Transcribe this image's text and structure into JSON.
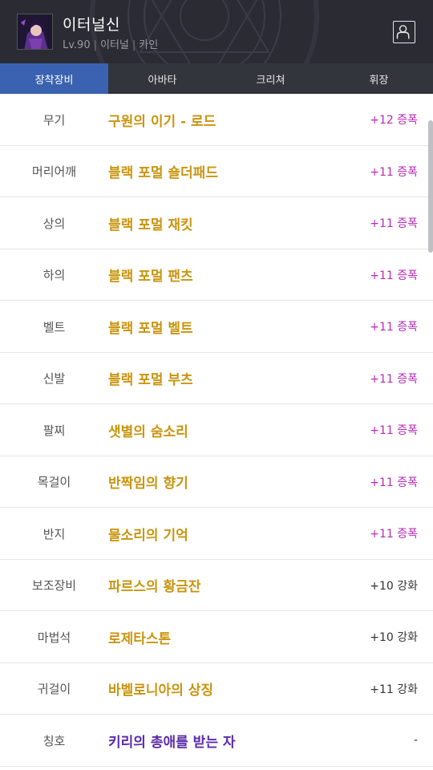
{
  "header": {
    "character_name": "이터널신",
    "level": "Lv.90",
    "class": "이터널",
    "server": "카인",
    "avatar_icon": "character-portrait",
    "profile_icon": "person-icon"
  },
  "tabs": [
    {
      "label": "장착장비",
      "active": true
    },
    {
      "label": "아바타",
      "active": false
    },
    {
      "label": "크리쳐",
      "active": false
    },
    {
      "label": "휘장",
      "active": false
    }
  ],
  "colors": {
    "gold": "#c9950f",
    "purple": "#5a2aa8",
    "magenta": "#b82ab8",
    "dark": "#333333",
    "tab_active": "#3a62b0"
  },
  "equipment": [
    {
      "slot": "무기",
      "item": "구원의 이기 - 로드",
      "upgrade": "+12 증폭",
      "item_color": "gold",
      "upgrade_color": "magenta"
    },
    {
      "slot": "머리어깨",
      "item": "블랙 포멀 숄더패드",
      "upgrade": "+11 증폭",
      "item_color": "gold",
      "upgrade_color": "magenta"
    },
    {
      "slot": "상의",
      "item": "블랙 포멀 재킷",
      "upgrade": "+11 증폭",
      "item_color": "gold",
      "upgrade_color": "magenta"
    },
    {
      "slot": "하의",
      "item": "블랙 포멀 팬츠",
      "upgrade": "+11 증폭",
      "item_color": "gold",
      "upgrade_color": "magenta"
    },
    {
      "slot": "벨트",
      "item": "블랙 포멀 벨트",
      "upgrade": "+11 증폭",
      "item_color": "gold",
      "upgrade_color": "magenta"
    },
    {
      "slot": "신발",
      "item": "블랙 포멀 부츠",
      "upgrade": "+11 증폭",
      "item_color": "gold",
      "upgrade_color": "magenta"
    },
    {
      "slot": "팔찌",
      "item": "샛별의 숨소리",
      "upgrade": "+11 증폭",
      "item_color": "gold",
      "upgrade_color": "magenta"
    },
    {
      "slot": "목걸이",
      "item": "반짝임의 향기",
      "upgrade": "+11 증폭",
      "item_color": "gold",
      "upgrade_color": "magenta"
    },
    {
      "slot": "반지",
      "item": "물소리의 기억",
      "upgrade": "+11 증폭",
      "item_color": "gold",
      "upgrade_color": "magenta"
    },
    {
      "slot": "보조장비",
      "item": "파르스의 황금잔",
      "upgrade": "+10 강화",
      "item_color": "gold",
      "upgrade_color": "dark"
    },
    {
      "slot": "마법석",
      "item": "로제타스톤",
      "upgrade": "+10 강화",
      "item_color": "gold",
      "upgrade_color": "dark"
    },
    {
      "slot": "귀걸이",
      "item": "바벨로니아의 상징",
      "upgrade": "+11 강화",
      "item_color": "gold",
      "upgrade_color": "dark"
    },
    {
      "slot": "칭호",
      "item": "키리의 총애를 받는 자",
      "upgrade": "-",
      "item_color": "purple",
      "upgrade_color": "dark"
    }
  ]
}
